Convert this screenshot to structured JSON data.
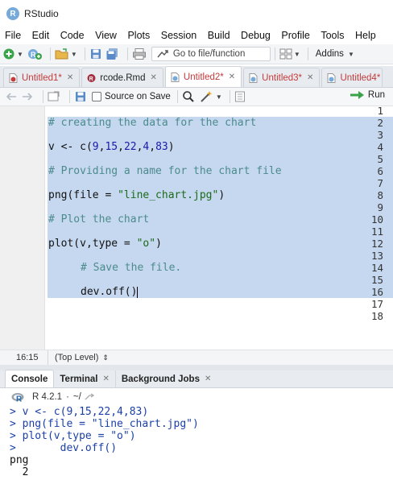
{
  "window": {
    "title": "RStudio"
  },
  "menu": [
    "File",
    "Edit",
    "Code",
    "View",
    "Plots",
    "Session",
    "Build",
    "Debug",
    "Profile",
    "Tools",
    "Help"
  ],
  "toolbar": {
    "goto_placeholder": "Go to file/function",
    "addins_label": "Addins"
  },
  "tabs": [
    {
      "label": "Untitled1*",
      "modified": true,
      "active": false
    },
    {
      "label": "rcode.Rmd",
      "modified": false,
      "active": false
    },
    {
      "label": "Untitled2*",
      "modified": true,
      "active": true
    },
    {
      "label": "Untitled3*",
      "modified": true,
      "active": false
    },
    {
      "label": "Untitled4*",
      "modified": true,
      "active": false
    }
  ],
  "editor_toolbar": {
    "source_on_save": "Source on Save",
    "run": "Run"
  },
  "editor": {
    "line_numbers": [
      "1",
      "2",
      "3",
      "4",
      "5",
      "6",
      "7",
      "8",
      "9",
      "10",
      "11",
      "12",
      "13",
      "14",
      "15",
      "16",
      "17",
      "18"
    ],
    "code": {
      "l2": "# creating the data for the chart",
      "l4_a": "v <- c(",
      "l4_nums": [
        "9",
        "15",
        "22",
        "4",
        "83"
      ],
      "l4_b": ")",
      "l6": "# Providing a name for the chart file",
      "l8_a": "png(file = ",
      "l8_str": "\"line_chart.jpg\"",
      "l8_b": ")",
      "l10": "# Plot the chart",
      "l12_a": "plot(v,type = ",
      "l12_str": "\"o\"",
      "l12_b": ")",
      "l14": "# Save the file.",
      "l16": "dev.off()"
    }
  },
  "status": {
    "position": "16:15",
    "scope": "(Top Level)"
  },
  "console_tabs": [
    {
      "label": "Console",
      "active": true,
      "closable": false
    },
    {
      "label": "Terminal",
      "active": false,
      "closable": true
    },
    {
      "label": "Background Jobs",
      "active": false,
      "closable": true
    }
  ],
  "console": {
    "r_version": "R 4.2.1",
    "dir": "~/",
    "lines": [
      {
        "text": "> v <- c(9,15,22,4,83)",
        "kind": "cmd"
      },
      {
        "text": "> png(file = \"line_chart.jpg\")",
        "kind": "cmd"
      },
      {
        "text": "> plot(v,type = \"o\")",
        "kind": "cmd"
      },
      {
        "text": ">       dev.off()",
        "kind": "cmd"
      },
      {
        "text": "png",
        "kind": "out"
      },
      {
        "text": "  2",
        "kind": "out"
      }
    ]
  },
  "colors": {
    "selection": "#c6d8f0",
    "comment": "#4b8b8b",
    "string": "#1a6b1a",
    "number": "#1a1aa6",
    "modified_tab": "#c43b3b"
  }
}
